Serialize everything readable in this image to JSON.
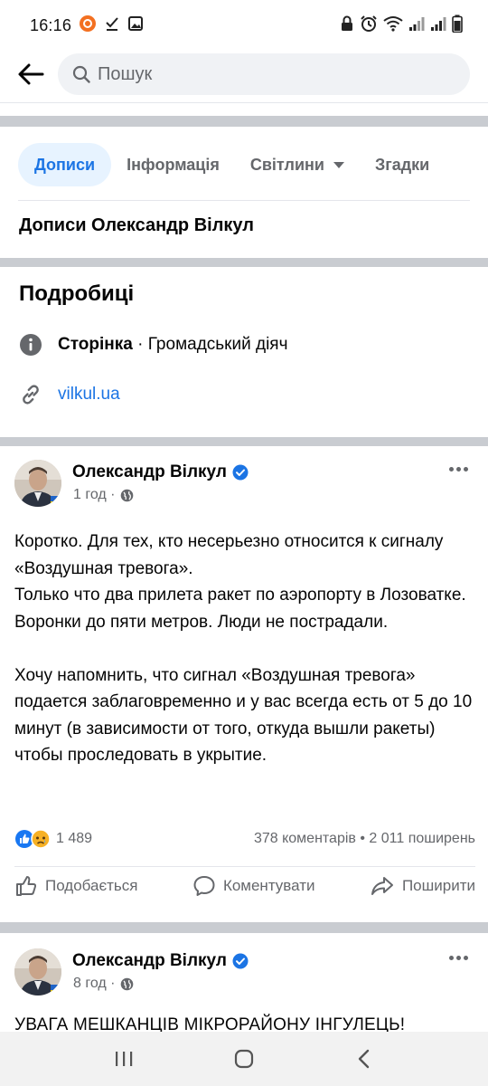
{
  "status_bar": {
    "time": "16:16"
  },
  "search": {
    "placeholder": "Пошук"
  },
  "tabs": [
    {
      "label": "Дописи",
      "active": true
    },
    {
      "label": "Інформація",
      "active": false
    },
    {
      "label": "Світлини",
      "active": false,
      "has_dropdown": true
    },
    {
      "label": "Згадки",
      "active": false
    }
  ],
  "posts_heading": "Дописи Олександр Вілкул",
  "details": {
    "title": "Подробиці",
    "category_label": "Сторінка",
    "category_value": "· Громадський діяч",
    "website": "vilkul.ua"
  },
  "post1": {
    "author": "Олександр Вілкул",
    "time": "1 год ·",
    "text_p1": "Коротко. Для тех, кто несерьезно относится к сигналу «Воздушная тревога».",
    "text_p2": "Только что два прилета ракет по аэропорту в Лозоватке. Воронки до пяти метров. Люди не пострадали.",
    "text_p3": "Хочу напомнить, что сигнал «Воздушная тревога» подается заблаговременно и у вас всегда есть от 5 до 10 минут (в зависимости от того, откуда вышли ракеты) чтобы проследовать в укрытие.",
    "reactions_count": "1 489",
    "comments_shares": "378 коментарів • 2 011 поширень"
  },
  "actions": {
    "like": "Подобається",
    "comment": "Коментувати",
    "share": "Поширити"
  },
  "post2": {
    "author": "Олександр Вілкул",
    "time": "8 год ·",
    "text_start": "УВАГА МЕШКАНЦІВ МІКРОРАЙОНУ ІНГУЛЕЦЬ!"
  },
  "colors": {
    "accent": "#1b74e4",
    "active_tab_bg": "#e7f3ff",
    "secondary_text": "#65676b",
    "divider": "#c9ccd1"
  }
}
